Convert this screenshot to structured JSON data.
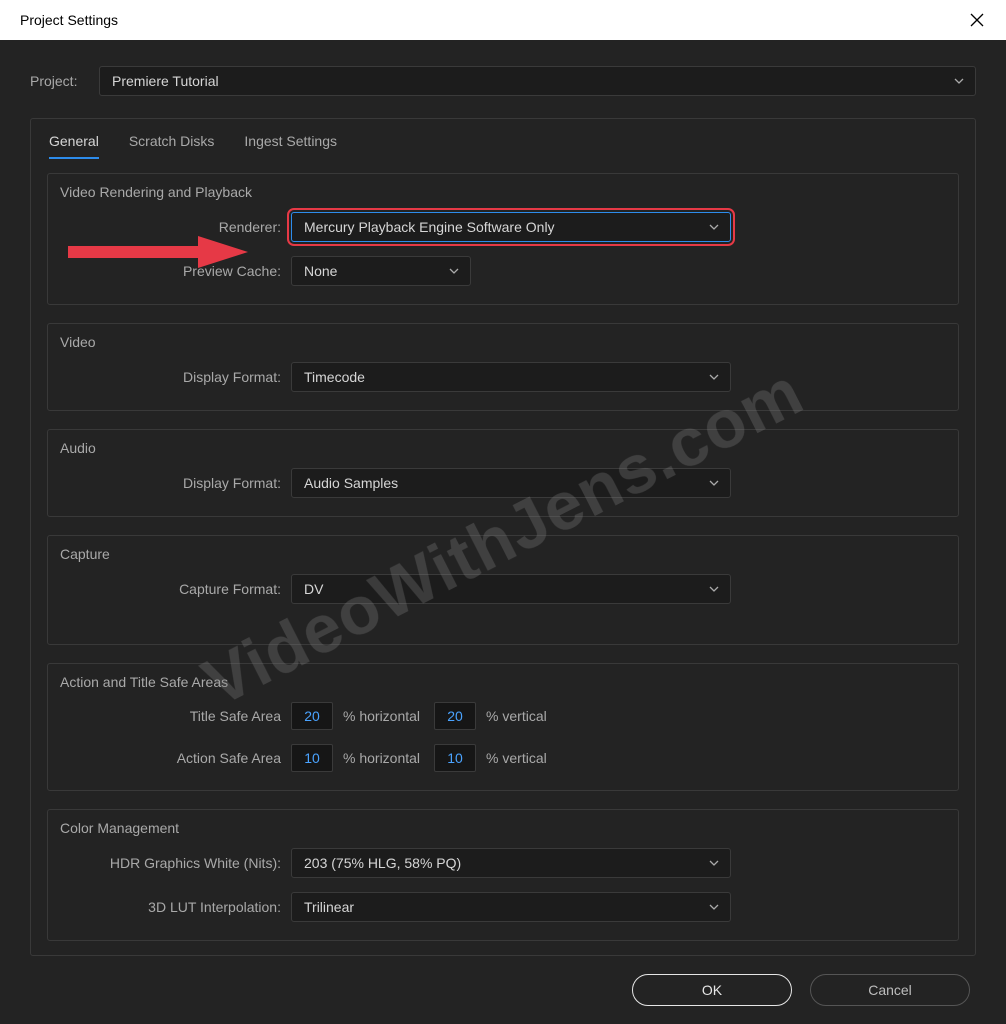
{
  "window": {
    "title": "Project Settings"
  },
  "project": {
    "label": "Project:",
    "value": "Premiere Tutorial"
  },
  "tabs": {
    "general": "General",
    "scratch": "Scratch Disks",
    "ingest": "Ingest Settings"
  },
  "vrp": {
    "legend": "Video Rendering and Playback",
    "renderer_label": "Renderer:",
    "renderer_value": "Mercury Playback Engine Software Only",
    "preview_label": "Preview Cache:",
    "preview_value": "None"
  },
  "video": {
    "legend": "Video",
    "display_label": "Display Format:",
    "display_value": "Timecode"
  },
  "audio": {
    "legend": "Audio",
    "display_label": "Display Format:",
    "display_value": "Audio Samples"
  },
  "capture": {
    "legend": "Capture",
    "format_label": "Capture Format:",
    "format_value": "DV"
  },
  "safe": {
    "legend": "Action and Title Safe Areas",
    "title_label": "Title Safe Area",
    "title_h": "20",
    "title_v": "20",
    "action_label": "Action Safe Area",
    "action_h": "10",
    "action_v": "10",
    "pct_h": "% horizontal",
    "pct_v": "% vertical"
  },
  "color": {
    "legend": "Color Management",
    "hdr_label": "HDR Graphics White (Nits):",
    "hdr_value": "203 (75% HLG, 58% PQ)",
    "lut_label": "3D LUT Interpolation:",
    "lut_value": "Trilinear"
  },
  "buttons": {
    "ok": "OK",
    "cancel": "Cancel"
  },
  "watermark": "VideoWithJens.com"
}
